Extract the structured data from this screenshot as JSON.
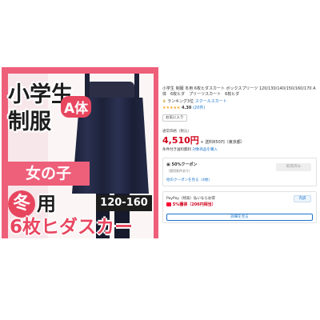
{
  "product_image": {
    "title_line1": "小学生",
    "title_line2": "制服",
    "a_badge": "A体",
    "girls_banner": "女の子",
    "winter_mark": "冬",
    "winter_use": "用",
    "size_range": "120-160",
    "pleats_text": "6枚ヒダスカー",
    "favorite_icon": "heart-icon",
    "accent_color": "#ee5f7a"
  },
  "info": {
    "title": "小学生 制服 冬用 6枚ヒダスカート ボックスプリーツ 120/130/140/150/160/170 A 体　6枚ヒダ　プリーツスカート　6枚ヒダ",
    "ranking_label": "ランキング3位",
    "ranking_category": "スクールスカート",
    "stars": "★★★★★",
    "rating": "4.30",
    "reviews": "(20件)",
    "review_button": "お気に入り",
    "price_label": "通常価格（税込）",
    "price": "4,510円",
    "shipping": "+ 送料850円（東京都）",
    "free_shipping_text": "条件付き送料無料",
    "free_shipping_link": "対象商品を購入",
    "coupon_title": "50%クーポン",
    "coupon_sub": "（適用条件あり）",
    "coupon_get": "取得済み",
    "coupon_link": "他のクーポンを見る（4枚）",
    "paypay_text": "PayPay（残高）払いならお得",
    "paypay_rate": "5%獲得（206円相当）",
    "paypay_detail": "内訳",
    "paypay_button": "詳細を見る",
    "price_color": "#d0021b",
    "link_color": "#1a73c9"
  }
}
